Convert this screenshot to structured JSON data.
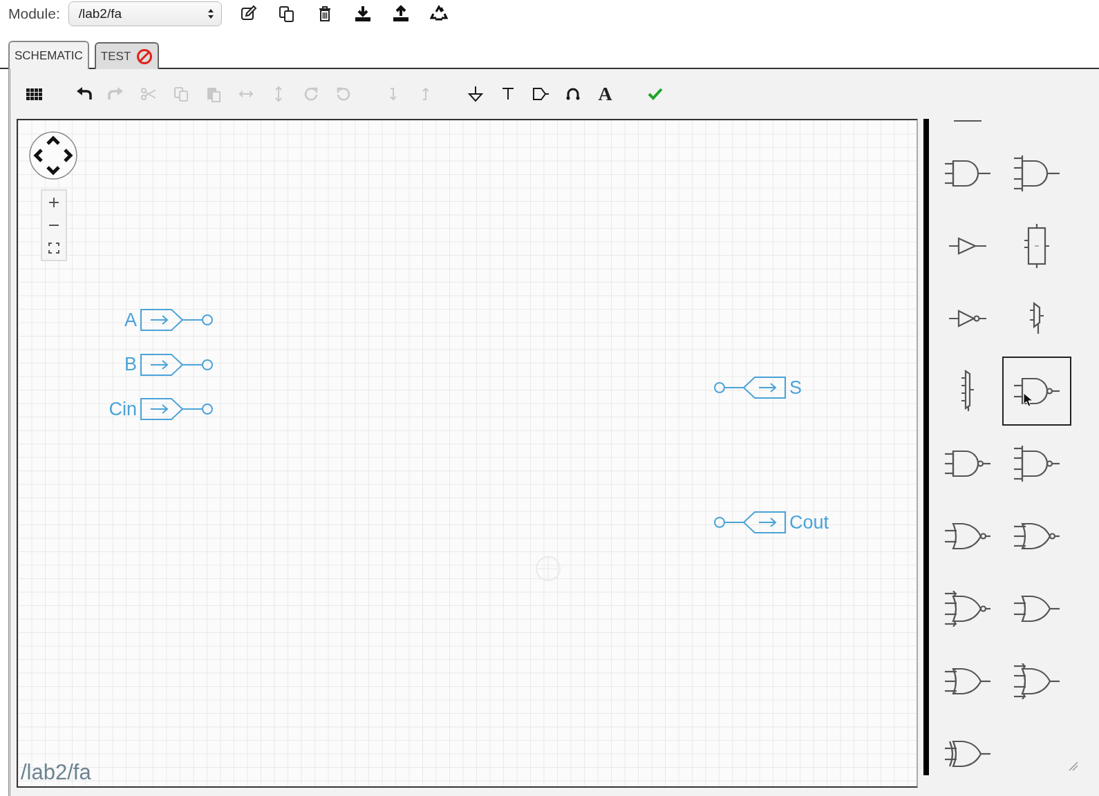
{
  "module_bar": {
    "label": "Module:",
    "select": {
      "value": "/lab2/fa"
    },
    "actions": [
      {
        "kind": "edit"
      },
      {
        "kind": "copy"
      },
      {
        "kind": "delete"
      },
      {
        "kind": "download"
      },
      {
        "kind": "upload"
      },
      {
        "kind": "recycle"
      }
    ]
  },
  "tabs": [
    {
      "label": "SCHEMATIC",
      "selected": true,
      "error": false
    },
    {
      "label": "TEST",
      "selected": false,
      "error": true
    }
  ],
  "toolbar": {
    "groups": [
      [
        {
          "kind": "grid",
          "disabled": false
        }
      ],
      [
        {
          "kind": "undo",
          "disabled": false
        },
        {
          "kind": "redo",
          "disabled": true
        },
        {
          "kind": "cut",
          "disabled": true
        },
        {
          "kind": "copy",
          "disabled": true
        },
        {
          "kind": "paste",
          "disabled": true
        },
        {
          "kind": "fliph",
          "disabled": true
        },
        {
          "kind": "flipv",
          "disabled": true
        },
        {
          "kind": "rotcw",
          "disabled": true
        },
        {
          "kind": "rotccw",
          "disabled": true
        }
      ],
      [
        {
          "kind": "down",
          "disabled": true
        },
        {
          "kind": "up",
          "disabled": true
        }
      ],
      [
        {
          "kind": "ground",
          "disabled": false
        },
        {
          "kind": "vdd",
          "disabled": false
        },
        {
          "kind": "port",
          "disabled": false
        },
        {
          "kind": "jumper",
          "disabled": false
        },
        {
          "kind": "text",
          "glyph": "A",
          "disabled": false
        }
      ],
      [
        {
          "kind": "check",
          "disabled": false
        }
      ]
    ]
  },
  "canvas": {
    "ports": [
      {
        "label": "A",
        "kind": "input"
      },
      {
        "label": "B",
        "kind": "input"
      },
      {
        "label": "Cin",
        "kind": "input"
      },
      {
        "label": "S",
        "kind": "output"
      },
      {
        "label": "Cout",
        "kind": "output"
      }
    ],
    "zoom_controls": [
      {
        "kind": "in"
      },
      {
        "kind": "out"
      },
      {
        "kind": "fit"
      }
    ],
    "module_path": "/lab2/fa"
  },
  "palette": {
    "items": [
      {
        "kind": "clipped"
      },
      {
        "kind": "and3",
        "selected": false
      },
      {
        "kind": "and4",
        "selected": false
      },
      {
        "kind": "buffer",
        "selected": false
      },
      {
        "kind": "block",
        "selected": false
      },
      {
        "kind": "inverter",
        "selected": false
      },
      {
        "kind": "mux2",
        "selected": false
      },
      {
        "kind": "mux4",
        "selected": false
      },
      {
        "kind": "nand2",
        "selected": true
      },
      {
        "kind": "nand3",
        "selected": false
      },
      {
        "kind": "nand4",
        "selected": false
      },
      {
        "kind": "nor2",
        "selected": false
      },
      {
        "kind": "nor3",
        "selected": false
      },
      {
        "kind": "nor4",
        "selected": false
      },
      {
        "kind": "or2",
        "selected": false
      },
      {
        "kind": "or3",
        "selected": false
      },
      {
        "kind": "or4",
        "selected": false
      },
      {
        "kind": "xor2",
        "selected": false
      }
    ]
  }
}
